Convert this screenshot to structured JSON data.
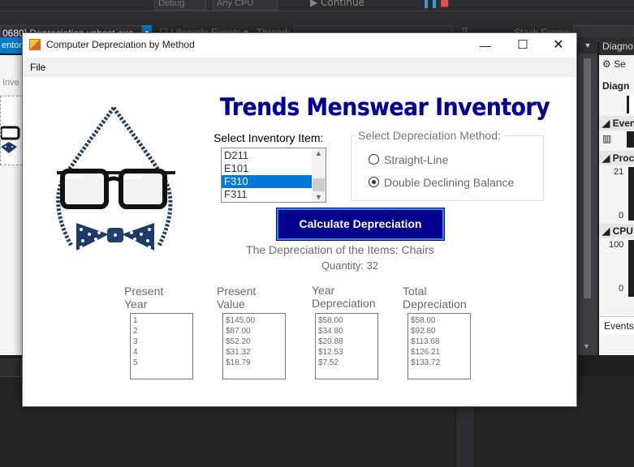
{
  "vs": {
    "toolbar_items": [
      "Debug",
      "Any CPU",
      "Continue"
    ],
    "process_label": "0680] Depreciation.vshost.exe",
    "lifecycle_label": "Lifecycle Events",
    "thread_label": "Thread:",
    "stack_frame_label": "Stack Frame:",
    "left_tab": "entory",
    "left_panel_text": "Inve",
    "diagnostics": {
      "title": "Diagno",
      "settings": "Se",
      "session_label": "Diagn",
      "events_section": "Even",
      "process_section": "Proc",
      "process_max": "21",
      "process_min": "0",
      "cpu_section": "CPU",
      "cpu_max": "100",
      "cpu_min": "0",
      "events_tab": "Events"
    }
  },
  "window": {
    "title": "Computer Depreciation by Method",
    "minimize": "—",
    "maximize": "☐",
    "close": "✕"
  },
  "menu": {
    "file": "File"
  },
  "form": {
    "heading": "Trends Menswear Inventory",
    "select_item_label": "Select Inventory Item:",
    "inventory_items": [
      "D211",
      "E101",
      "F310",
      "F311"
    ],
    "selected_item": "F310",
    "method_group_label": "Select Depreciation Method:",
    "methods": [
      {
        "label": "Straight-Line",
        "checked": false
      },
      {
        "label": "Double Declining Balance",
        "checked": true
      }
    ],
    "calculate_button": "Calculate Depreciation",
    "result_line1": "The Depreciation of the Items: Chairs",
    "result_line2": "Quantity: 32",
    "columns": [
      {
        "header1": "Present",
        "header2": "Year",
        "values": [
          "1",
          "2",
          "3",
          "4",
          "5"
        ]
      },
      {
        "header1": "Present",
        "header2": "Value",
        "values": [
          "$145.00",
          "$87.00",
          "$52.20",
          "$31.32",
          "$18.79"
        ]
      },
      {
        "header1": "Year",
        "header2": "Depreciation",
        "values": [
          "$58.00",
          "$34.80",
          "$20.88",
          "$12.53",
          "$7.52"
        ]
      },
      {
        "header1": "Total",
        "header2": "Depreciation",
        "values": [
          "$58.00",
          "$92.80",
          "$113.68",
          "$126.21",
          "$133.72"
        ]
      }
    ]
  },
  "colors": {
    "heading": "#00008b",
    "button_bg": "#00008b",
    "selection": "#0078d7",
    "vs_accent": "#007acc"
  }
}
